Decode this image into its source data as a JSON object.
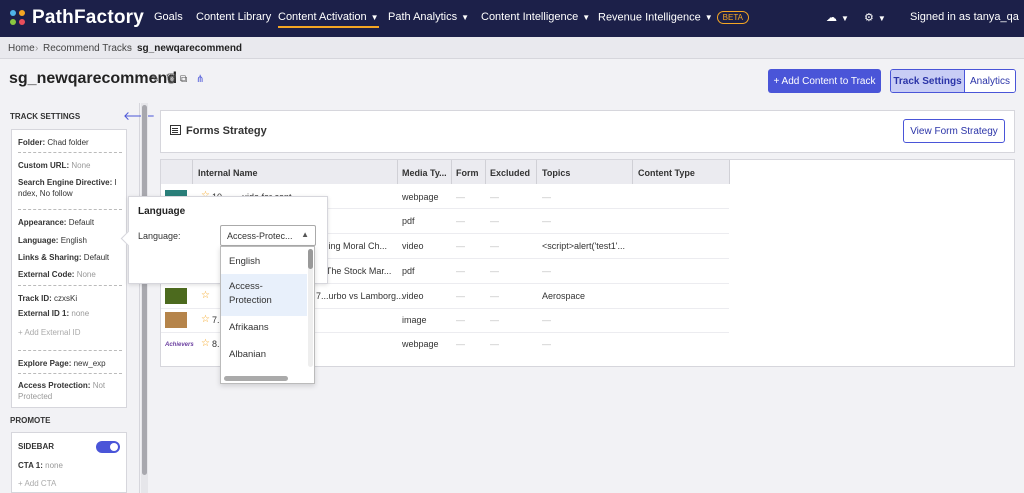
{
  "nav": {
    "logo": "PathFactory",
    "items": [
      {
        "label": "Goals",
        "caret": false
      },
      {
        "label": "Content Library",
        "caret": false
      },
      {
        "label": "Content Activation",
        "caret": true
      },
      {
        "label": "Path Analytics",
        "caret": true
      },
      {
        "label": "Content Intelligence",
        "caret": true
      },
      {
        "label": "Revenue Intelligence",
        "caret": true
      }
    ],
    "beta": "BETA",
    "user": "Signed in as tanya_qa"
  },
  "breadcrumb": {
    "home": "Home",
    "parent": "Recommend Tracks",
    "current": "sg_newqarecommend"
  },
  "page": {
    "title": "sg_newqarecommend",
    "add_content": "+ Add Content to Track",
    "track_settings": "Track Settings",
    "analytics": "Analytics"
  },
  "sidebar": {
    "heading": "TRACK SETTINGS",
    "folder_label": "Folder:",
    "folder_value": "Chad folder",
    "custom_url_label": "Custom URL:",
    "custom_url_value": "None",
    "seo_label": "Search Engine Directive:",
    "seo_value_1": "I",
    "seo_value_2": "ndex, No follow",
    "appearance_label": "Appearance:",
    "appearance_value": "Default",
    "language_label": "Language:",
    "language_value": "English",
    "links_label": "Links & Sharing:",
    "links_value": "Default",
    "external_code_label": "External Code:",
    "external_code_value": "None",
    "track_id_label": "Track ID:",
    "track_id_value": "czxsKi",
    "external_id_label": "External ID 1:",
    "external_id_value": "none",
    "add_external_id": "+ Add External ID",
    "explore_label": "Explore Page:",
    "explore_value": "new_exp",
    "access_label": "Access Protection:",
    "access_value_1": "Not",
    "access_value_2": "Protected",
    "promote_heading": "PROMOTE",
    "sidebar_label": "SIDEBAR",
    "cta_label": "CTA 1:",
    "cta_value": "none",
    "add_cta": "+ Add CTA"
  },
  "forms": {
    "title": "Forms Strategy",
    "view_button": "View Form Strategy"
  },
  "table": {
    "columns": [
      "Internal Name",
      "Media Ty...",
      "Form",
      "Excluded",
      "Topics",
      "Content Type"
    ],
    "rows": [
      {
        "name": "10 ... ...uide for cont...",
        "media": "webpage",
        "form": "—",
        "excluded": "—",
        "topics": "—"
      },
      {
        "name": "",
        "media": "pdf",
        "form": "—",
        "excluded": "—",
        "topics": "—"
      },
      {
        "name": "...hing Moral Ch...",
        "media": "video",
        "form": "—",
        "excluded": "—",
        "topics": "<script>alert('test1'..."
      },
      {
        "name": "... The Stock Mar...",
        "media": "pdf",
        "form": "—",
        "excluded": "—",
        "topics": "—"
      },
      {
        "name": "7...urbo vs Lamborg...",
        "media": "video",
        "form": "—",
        "excluded": "—",
        "topics": "Aerospace"
      },
      {
        "name": "7...",
        "media": "image",
        "form": "—",
        "excluded": "—",
        "topics": "—"
      },
      {
        "name": "8...",
        "media": "webpage",
        "form": "—",
        "excluded": "—",
        "topics": "—"
      }
    ]
  },
  "language_popover": {
    "title": "Language",
    "label": "Language:",
    "selected": "Access-Protec...",
    "options": [
      "English",
      "Access-",
      "Protection",
      "Afrikaans",
      "Albanian"
    ]
  },
  "thumb_text": "Achievers"
}
